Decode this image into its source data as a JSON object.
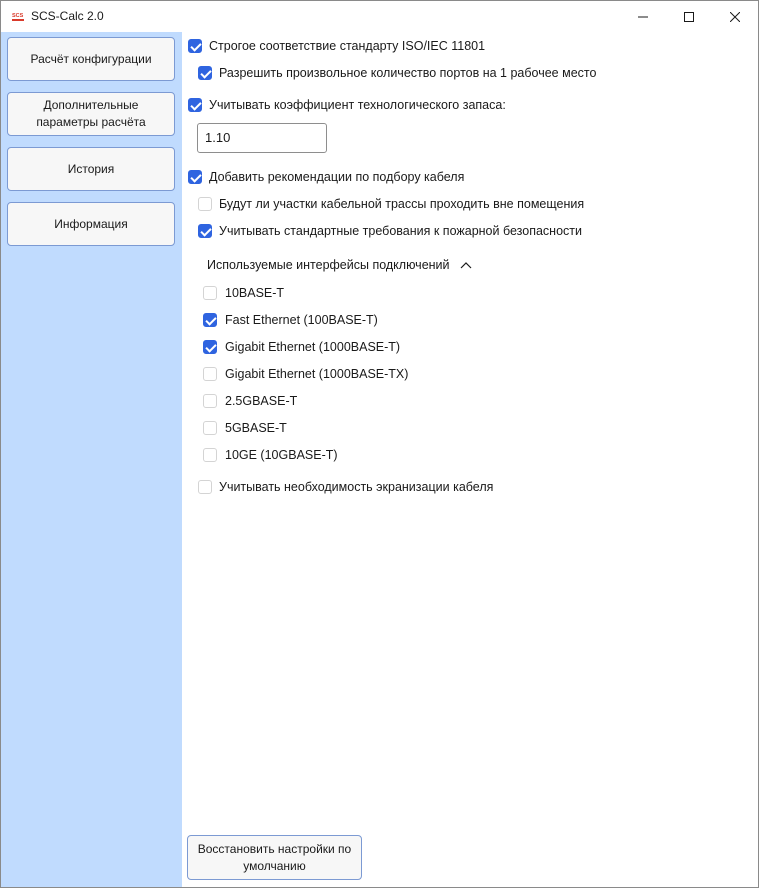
{
  "window": {
    "title": "SCS-Calc 2.0",
    "icon": "scs-app-icon"
  },
  "sidebar": {
    "items": [
      {
        "label": "Расчёт конфигурации"
      },
      {
        "label": "Дополнительные\nпараметры расчёта"
      },
      {
        "label": "История"
      },
      {
        "label": "Информация"
      }
    ]
  },
  "options": {
    "strict_iso": {
      "label": "Строгое соответствие стандарту ISO/IEC 11801",
      "checked": true
    },
    "arbitrary_ports": {
      "label": "Разрешить произвольное количество портов на 1 рабочее место",
      "checked": true
    },
    "tech_reserve": {
      "label": "Учитывать коэффициент технологического запаса:",
      "checked": true,
      "value": "1.10"
    },
    "cable_recommendations": {
      "label": "Добавить рекомендации по подбору кабеля",
      "checked": true
    },
    "outdoor_sections": {
      "label": "Будут ли участки кабельной трассы проходить вне помещения",
      "checked": false
    },
    "fire_safety": {
      "label": "Учитывать стандартные требования к пожарной безопасности",
      "checked": true
    },
    "interfaces": {
      "header": "Используемые интерфейсы подключений",
      "expanded": true,
      "items": [
        {
          "label": "10BASE-T",
          "checked": false
        },
        {
          "label": "Fast Ethernet (100BASE-T)",
          "checked": true
        },
        {
          "label": "Gigabit Ethernet (1000BASE-T)",
          "checked": true
        },
        {
          "label": "Gigabit Ethernet (1000BASE-TX)",
          "checked": false
        },
        {
          "label": "2.5GBASE-T",
          "checked": false
        },
        {
          "label": "5GBASE-T",
          "checked": false
        },
        {
          "label": "10GE (10GBASE-T)",
          "checked": false
        }
      ]
    },
    "shielding": {
      "label": "Учитывать необходимость экранизации кабеля",
      "checked": false
    }
  },
  "reset_button": {
    "label": "Восстановить настройки по\nумолчанию"
  },
  "colors": {
    "sidebar_bg": "#c0dbfe",
    "checkbox_on": "#2f64e0",
    "button_border": "#7c9ad3"
  }
}
